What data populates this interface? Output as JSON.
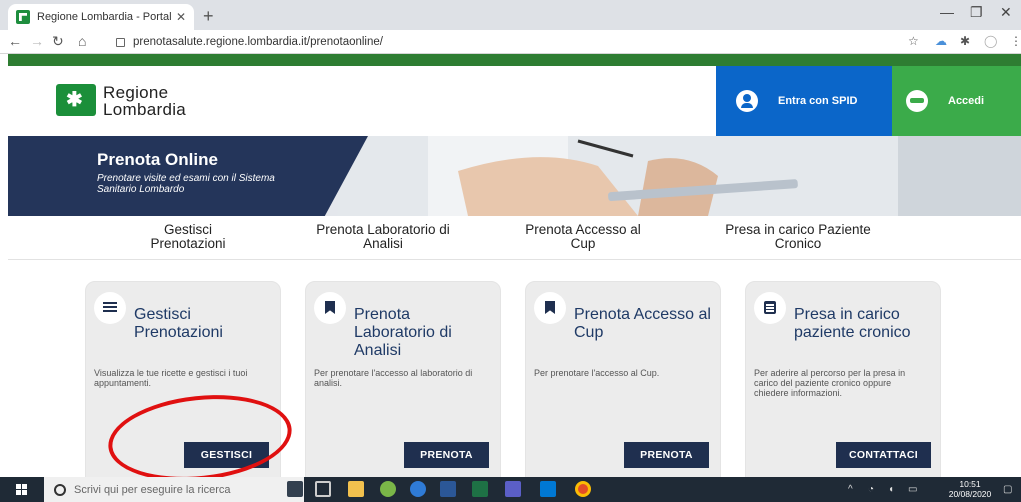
{
  "browser": {
    "tab_title": "Regione Lombardia - Portale Pre...",
    "url": "prenotasalute.regione.lombardia.it/prenotaonline/"
  },
  "header": {
    "logo_line1": "Regione",
    "logo_line2": "Lombardia",
    "spid_label": "Entra con SPID",
    "accedi_label": "Accedi",
    "spid_color": "#0b66c9",
    "accedi_color": "#3bab4a",
    "brand_green": "#2e7d32"
  },
  "banner": {
    "title": "Prenota Online",
    "subtitle": "Prenotare visite ed esami con il Sistema Sanitario Lombardo"
  },
  "nav": [
    {
      "line1": "Gestisci",
      "line2": "Prenotazioni"
    },
    {
      "line1": "Prenota Laboratorio di",
      "line2": "Analisi"
    },
    {
      "line1": "Prenota Accesso al",
      "line2": "Cup"
    },
    {
      "line1": "Presa in carico Paziente",
      "line2": "Cronico"
    }
  ],
  "cards": [
    {
      "icon": "list-icon",
      "title": "Gestisci Prenotazioni",
      "desc": "Visualizza le tue ricette e gestisci i tuoi appuntamenti.",
      "button": "GESTISCI"
    },
    {
      "icon": "bookmark-icon",
      "title": "Prenota Laboratorio di Analisi",
      "desc": "Per prenotare l'accesso al laboratorio di analisi.",
      "button": "PRENOTA"
    },
    {
      "icon": "bookmark-icon",
      "title": "Prenota Accesso al Cup",
      "desc": "Per prenotare l'accesso al Cup.",
      "button": "PRENOTA"
    },
    {
      "icon": "document-icon",
      "title": "Presa in carico paziente cronico",
      "desc": "Per aderire al percorso per la presa in carico del paziente cronico oppure chiedere informazioni.",
      "button": "CONTATTACI"
    }
  ],
  "taskbar": {
    "search_placeholder": "Scrivi qui per eseguire la ricerca",
    "time": "10:51",
    "date": "20/08/2020"
  },
  "colors": {
    "button_dark": "#1f2f4f",
    "card_title": "#1f3a66",
    "annotation": "#e01010"
  }
}
